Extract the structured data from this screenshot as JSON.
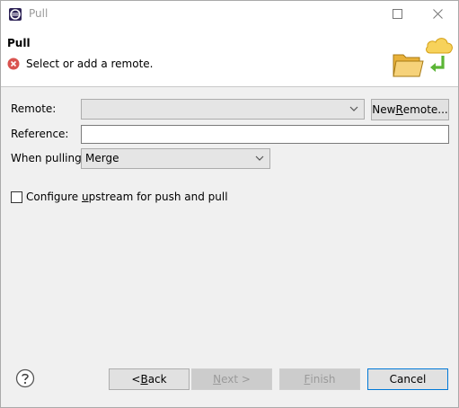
{
  "window": {
    "title": "Pull"
  },
  "banner": {
    "title": "Pull",
    "message": "Select or add a remote."
  },
  "form": {
    "remote_label": "Remote:",
    "remote_value": "",
    "new_remote_pre": "New ",
    "new_remote_u": "R",
    "new_remote_post": "emote...",
    "reference_label": "Reference:",
    "reference_value": "",
    "when_pulling_label": "When pulling:",
    "when_pulling_value": "Merge",
    "configure_pre": "Configure ",
    "configure_u": "u",
    "configure_post": "pstream for push and pull",
    "configure_checked": false
  },
  "footer": {
    "back_pre": "< ",
    "back_u": "B",
    "back_post": "ack",
    "next_u": "N",
    "next_post": "ext >",
    "finish_u": "F",
    "finish_post": "inish",
    "cancel": "Cancel"
  },
  "colors": {
    "error": "#d9534f",
    "folder": "#f2c04e",
    "cloud": "#f7c843",
    "arrow": "#6abf3a",
    "focus": "#0078d7"
  }
}
